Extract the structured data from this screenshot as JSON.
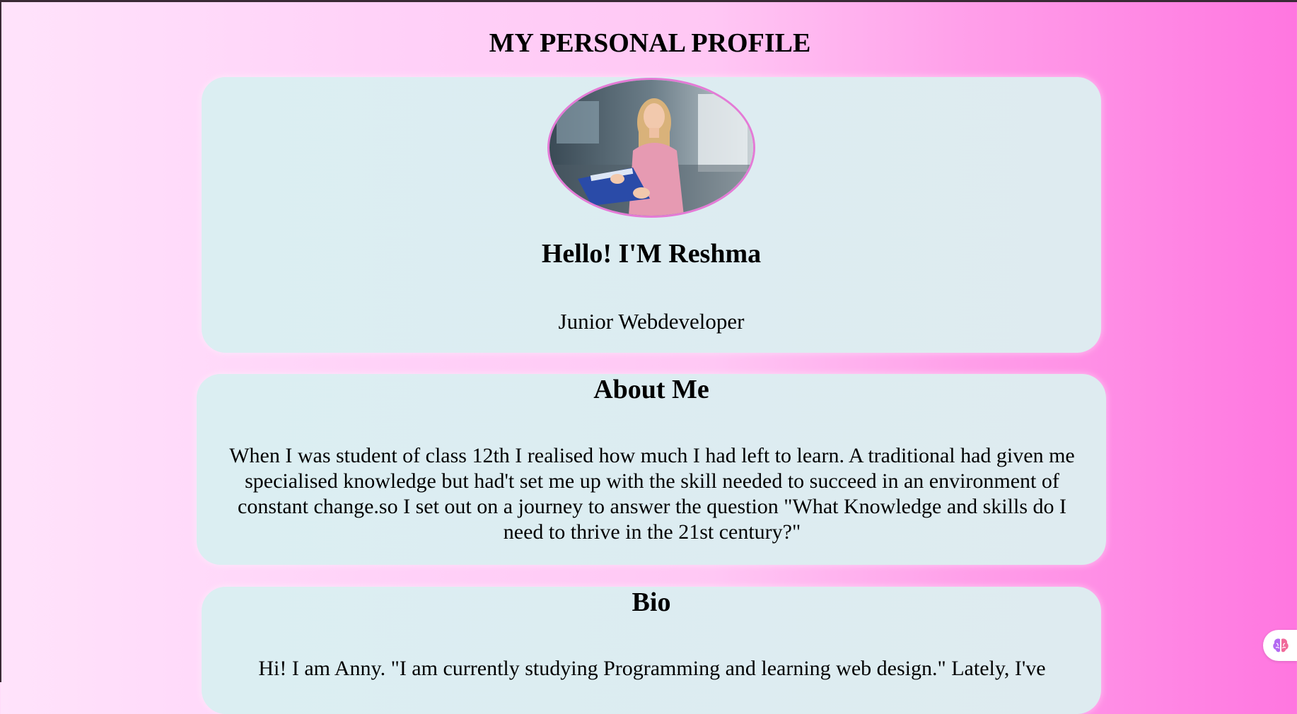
{
  "page": {
    "title": "MY PERSONAL PROFILE"
  },
  "profile": {
    "avatar_alt": "profile-photo",
    "greeting": "Hello! I'M Reshma",
    "role": "Junior Webdeveloper"
  },
  "about": {
    "heading": "About Me",
    "text": "When I was student of class 12th I realised how much I had left to learn. A traditional had given me specialised knowledge but had't set me up with the skill needed to succeed in an environment of constant change.so I set out on a journey to answer the question \"What Knowledge and skills do I need to thrive in the 21st century?\""
  },
  "bio": {
    "heading": "Bio",
    "text": "Hi! I am Anny. \"I am currently studying Programming and learning web design.\" Lately, I've"
  },
  "colors": {
    "card_bg": "#dbeef2",
    "avatar_border": "#e47ad6",
    "bg_left": "#ffe3fb",
    "bg_right": "#ff76e0"
  },
  "icons": {
    "floating_widget": "brain-icon"
  }
}
